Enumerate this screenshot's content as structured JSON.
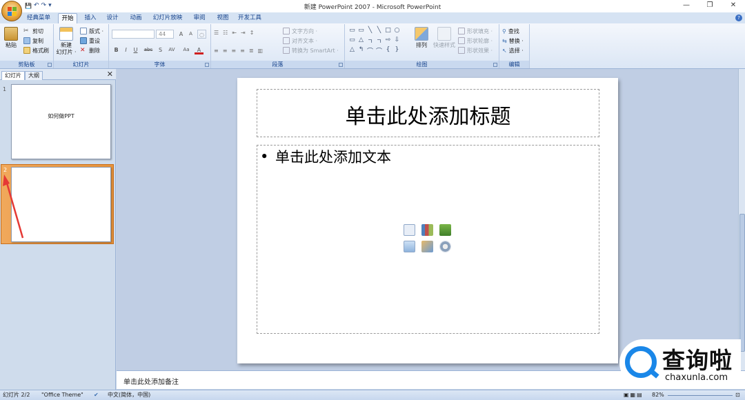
{
  "window": {
    "title": "新建 PowerPoint 2007 - Microsoft PowerPoint",
    "controls": [
      "—",
      "❐",
      "✕"
    ]
  },
  "qat": {
    "save": "💾",
    "undo": "↶",
    "redo": "↷",
    "more": "▾"
  },
  "tabs": [
    "经典菜单",
    "开始",
    "插入",
    "设计",
    "动画",
    "幻灯片放映",
    "审阅",
    "视图",
    "开发工具"
  ],
  "active_tab": "开始",
  "ribbon": {
    "clipboard": {
      "label": "剪贴板",
      "paste": "粘贴",
      "cut": "剪切",
      "copy": "复制",
      "format_painter": "格式刷"
    },
    "slides": {
      "label": "幻灯片",
      "new_slide_line1": "新建",
      "new_slide_line2": "幻灯片 ·",
      "layout": "版式 ·",
      "reset": "重设",
      "delete": "删除"
    },
    "font": {
      "label": "字体",
      "font_name": "",
      "font_size": "44",
      "grow": "A",
      "shrink": "A",
      "bold": "B",
      "italic": "I",
      "underline": "U",
      "strike": "abc",
      "shadow": "S",
      "spacing": "AV",
      "case": "Aa",
      "color": "A"
    },
    "paragraph": {
      "label": "段落",
      "text_direction": "文字方向 ·",
      "align_text": "对齐文本 ·",
      "convert_smartart": "转换为 SmartArt ·"
    },
    "drawing": {
      "label": "绘图",
      "arrange": "排列",
      "quick_styles": "快速样式",
      "shape_fill": "形状填充 ·",
      "shape_outline": "形状轮廓 ·",
      "shape_effects": "形状效果 ·"
    },
    "editing": {
      "label": "编辑",
      "find": "查找",
      "replace": "替换 ·",
      "select": "选择 ·"
    }
  },
  "left_panel": {
    "tabs": [
      "幻灯片",
      "大纲"
    ],
    "close": "✕",
    "slides": [
      {
        "num": "1",
        "text": "如何做PPT"
      },
      {
        "num": "2",
        "text": ""
      }
    ]
  },
  "slide": {
    "title_placeholder": "单击此处添加标题",
    "bullet": "•",
    "body_placeholder": "单击此处添加文本"
  },
  "notes": {
    "placeholder": "单击此处添加备注"
  },
  "statusbar": {
    "slide_count": "幻灯片 2/2",
    "theme": "\"Office Theme\"",
    "language": "中文(简体，中国)",
    "zoom": "82%"
  },
  "watermark": {
    "brand_cn": "查询啦",
    "brand_en": "chaxunla.com"
  },
  "colors": {
    "ribbon_bg": "#dbe6f5",
    "selection": "#e8933a",
    "annotation_arrow": "#e53935",
    "watermark_blue": "#1a87e8"
  }
}
